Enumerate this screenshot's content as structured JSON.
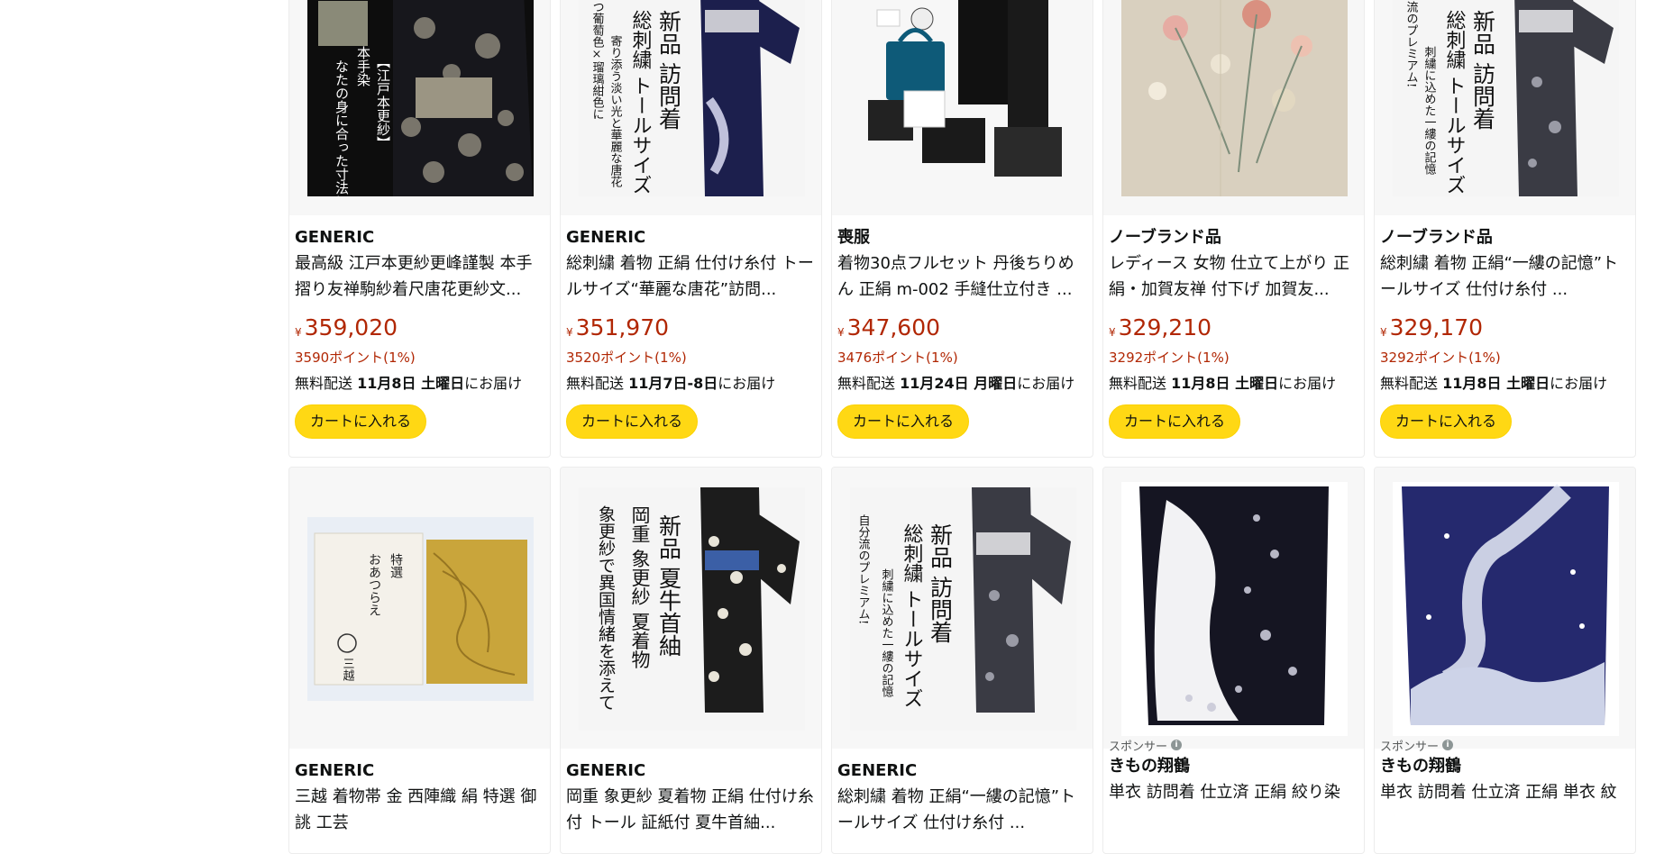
{
  "row1": [
    {
      "brand": "GENERIC",
      "title": "最高級 江戸本更紗更峰謹製 本手摺り友禅駒紗着尺唐花更紗文...",
      "price": "359,020",
      "currency": "¥",
      "points": "3590ポイント(1%)",
      "delivery_prefix": "無料配送 ",
      "delivery_date": "11月8日 土曜日",
      "delivery_suffix": "にお届け",
      "cart_label": "カートに入れる",
      "image_text": [
        "【江戸本更紗】",
        "本手染",
        "なたの身に合った寸法に"
      ]
    },
    {
      "brand": "GENERIC",
      "title": "総刺繍 着物 正絹 仕付け糸付 トールサイズ“華麗な唐花”訪問...",
      "price": "351,970",
      "currency": "¥",
      "points": "3520ポイント(1%)",
      "delivery_prefix": "無料配送 ",
      "delivery_date": "11月7日-8日",
      "delivery_suffix": "にお届け",
      "cart_label": "カートに入れる",
      "image_text": [
        "新品 訪問着",
        "総刺繍 トールサイズ",
        "寄り添う淡い光と華麗な唐花",
        "つ葡萄色×瑠璃紺色に"
      ]
    },
    {
      "brand": "喪服",
      "title": "着物30点フルセット 丹後ちりめん 正絹 m-002 手縫仕立付き ...",
      "price": "347,600",
      "currency": "¥",
      "points": "3476ポイント(1%)",
      "delivery_prefix": "無料配送 ",
      "delivery_date": "11月24日 月曜日",
      "delivery_suffix": "にお届け",
      "cart_label": "カートに入れる",
      "image_text": []
    },
    {
      "brand": "ノーブランド品",
      "title": "レディース 女物 仕立て上がり 正絹・加賀友禅 付下げ 加賀友...",
      "price": "329,210",
      "currency": "¥",
      "points": "3292ポイント(1%)",
      "delivery_prefix": "無料配送 ",
      "delivery_date": "11月8日 土曜日",
      "delivery_suffix": "にお届け",
      "cart_label": "カートに入れる",
      "image_text": []
    },
    {
      "brand": "ノーブランド品",
      "title": "総刺繍 着物 正絹“一縷の記憶”トールサイズ 仕付け糸付 ...",
      "price": "329,170",
      "currency": "¥",
      "points": "3292ポイント(1%)",
      "delivery_prefix": "無料配送 ",
      "delivery_date": "11月8日 土曜日",
      "delivery_suffix": "にお届け",
      "cart_label": "カートに入れる",
      "image_text": [
        "新品 訪問着",
        "総刺繍 トールサイズ",
        "刺繍に込めた一縷の記憶",
        "流のプレミアム!"
      ]
    }
  ],
  "row2": [
    {
      "sponsored": "",
      "brand": "GENERIC",
      "title": "三越 着物帯 金 西陣織 絹 特選 御誂 工芸",
      "image_text": [
        "特選",
        "おあつらえ",
        "三越"
      ]
    },
    {
      "sponsored": "",
      "brand": "GENERIC",
      "title": "岡重 象更紗 夏着物 正絹 仕付け糸付 トール 証紙付 夏牛首紬...",
      "image_text": [
        "新品 夏牛首紬",
        "岡重 象更紗 夏着物",
        "象更紗で異国情緒を添えて"
      ]
    },
    {
      "sponsored": "",
      "brand": "GENERIC",
      "title": "総刺繍 着物 正絹“一縷の記憶”トールサイズ 仕付け糸付 ...",
      "image_text": [
        "新品 訪問着",
        "総刺繍 トールサイズ",
        "刺繍に込めた一縷の記憶",
        "自分流のプレミアム!"
      ]
    },
    {
      "sponsored": "スポンサー",
      "brand": "きもの翔鶴",
      "title": "単衣 訪問着 仕立済 正絹 絞り染",
      "image_text": []
    },
    {
      "sponsored": "スポンサー",
      "brand": "きもの翔鶴",
      "title": "単衣 訪問着 仕立済 正絹 単衣 紋",
      "image_text": []
    }
  ],
  "colors": {
    "price": "#b12704",
    "button": "#ffd814",
    "card_border": "#ececec",
    "image_bg": "#f7f7f7"
  },
  "info_icon": "i"
}
